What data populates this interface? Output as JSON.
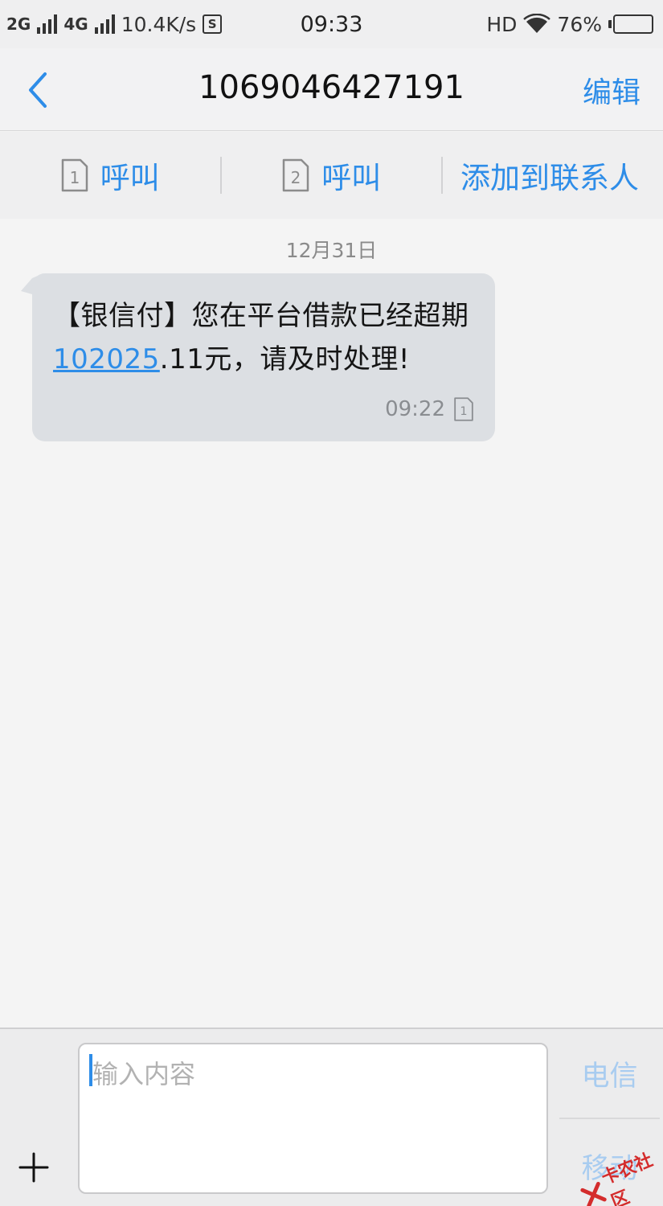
{
  "status_bar": {
    "net1": "2G",
    "net2": "4G",
    "speed": "10.4K/s",
    "s_icon_text": "S",
    "time": "09:33",
    "hd": "HD",
    "battery": "76%",
    "battery_level": 0.76
  },
  "header": {
    "title": "1069046427191",
    "edit_label": "编辑"
  },
  "actions": {
    "call1_sim": "1",
    "call1_label": "呼叫",
    "call2_sim": "2",
    "call2_label": "呼叫",
    "add_contact_label": "添加到联系人"
  },
  "conversation": {
    "date": "12月31日",
    "message": {
      "text_before": "【银信付】您在平台借款已经超期",
      "link_text": "102025",
      "text_after": ".11元，请及时处理!",
      "time": "09:22",
      "sim": "1"
    }
  },
  "composer": {
    "placeholder": "输入内容",
    "send_sim1_label": "电信",
    "send_sim2_label": "移动"
  },
  "watermark": {
    "text": "卡农社区"
  },
  "colors": {
    "accent": "#2e8de8",
    "bubble": "#dcdfe3",
    "disabled_send": "#a8ccf0"
  }
}
